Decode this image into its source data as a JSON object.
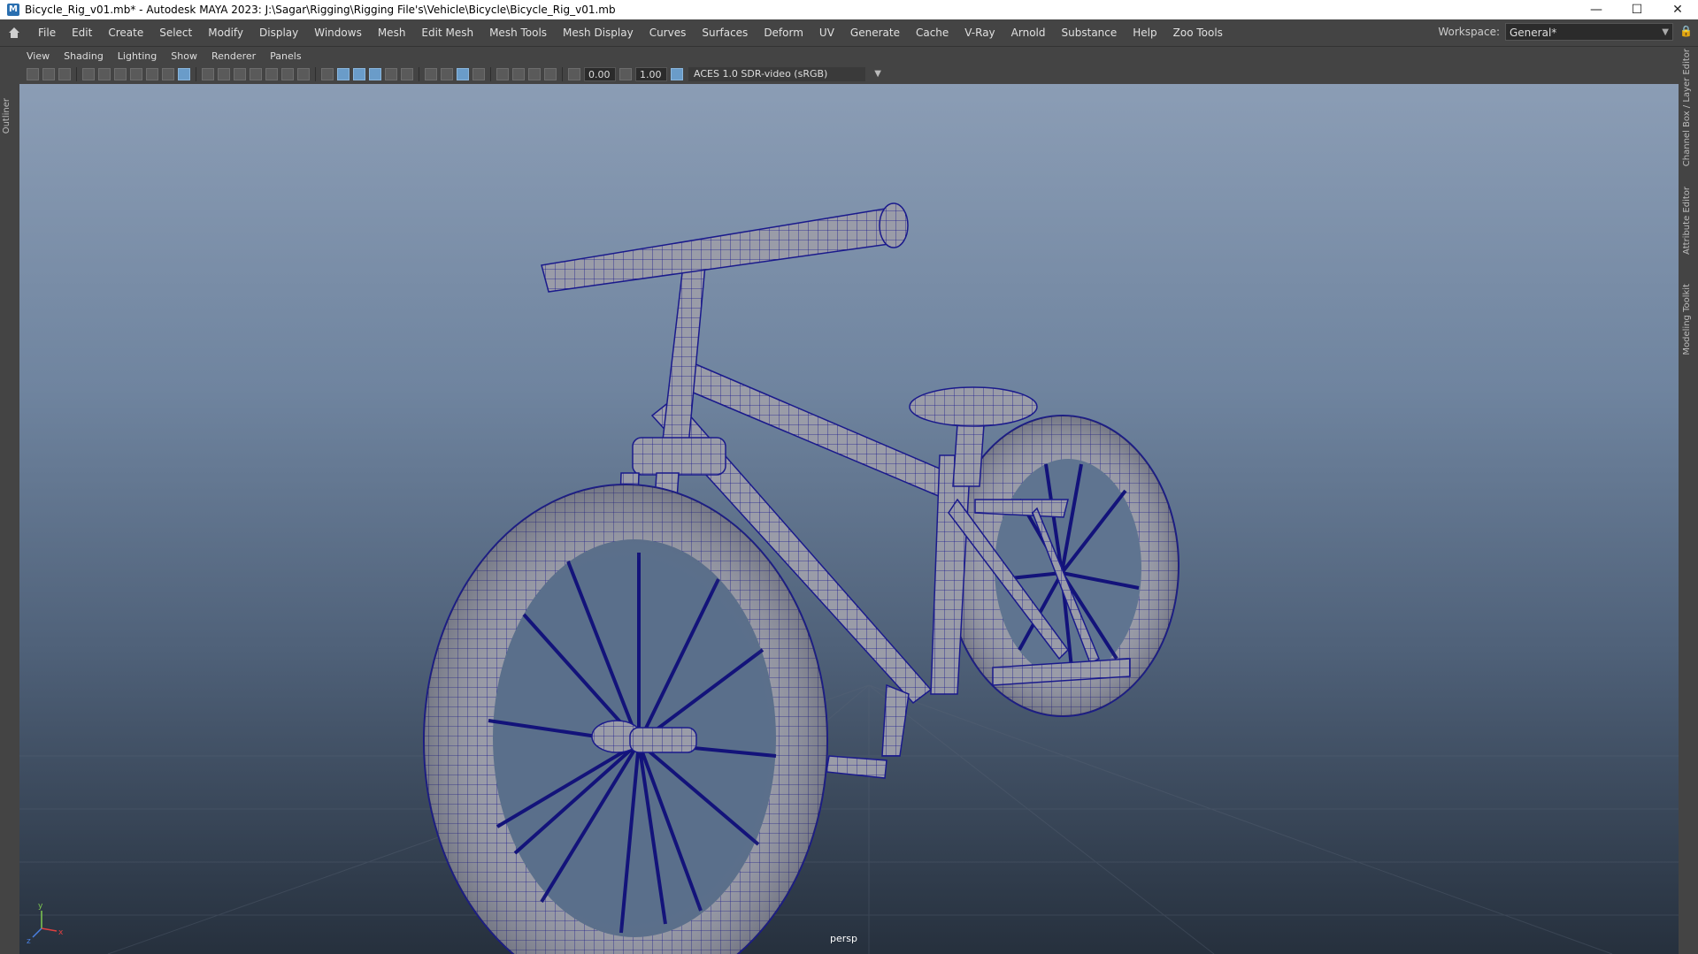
{
  "window": {
    "title": "Bicycle_Rig_v01.mb* - Autodesk MAYA 2023: J:\\Sagar\\Rigging\\Rigging File's\\Vehicle\\Bicycle\\Bicycle_Rig_v01.mb",
    "minimize": "—",
    "maximize": "☐",
    "close": "✕"
  },
  "menubar": {
    "items": [
      "File",
      "Edit",
      "Create",
      "Select",
      "Modify",
      "Display",
      "Windows",
      "Mesh",
      "Edit Mesh",
      "Mesh Tools",
      "Mesh Display",
      "Curves",
      "Surfaces",
      "Deform",
      "UV",
      "Generate",
      "Cache",
      "V-Ray",
      "Arnold",
      "Substance",
      "Help",
      "Zoo Tools"
    ],
    "workspace_label": "Workspace:",
    "workspace_value": "General*"
  },
  "side_tabs": {
    "left": "Outliner",
    "right": [
      "Channel Box / Layer Editor",
      "Attribute Editor",
      "Modeling Toolkit"
    ]
  },
  "panel_menu": [
    "View",
    "Shading",
    "Lighting",
    "Show",
    "Renderer",
    "Panels"
  ],
  "panel_toolbar": {
    "exposure": "0.00",
    "gamma": "1.00",
    "color_space": "ACES 1.0 SDR-video (sRGB)"
  },
  "viewport": {
    "camera": "persp",
    "axis_labels": {
      "x": "x",
      "y": "y",
      "z": "z"
    }
  },
  "colors": {
    "wireframe": "#1a1a8c",
    "mesh_fill": "#9a9ca8",
    "spokes": "#13137a",
    "accent": "#6a9cc9"
  }
}
